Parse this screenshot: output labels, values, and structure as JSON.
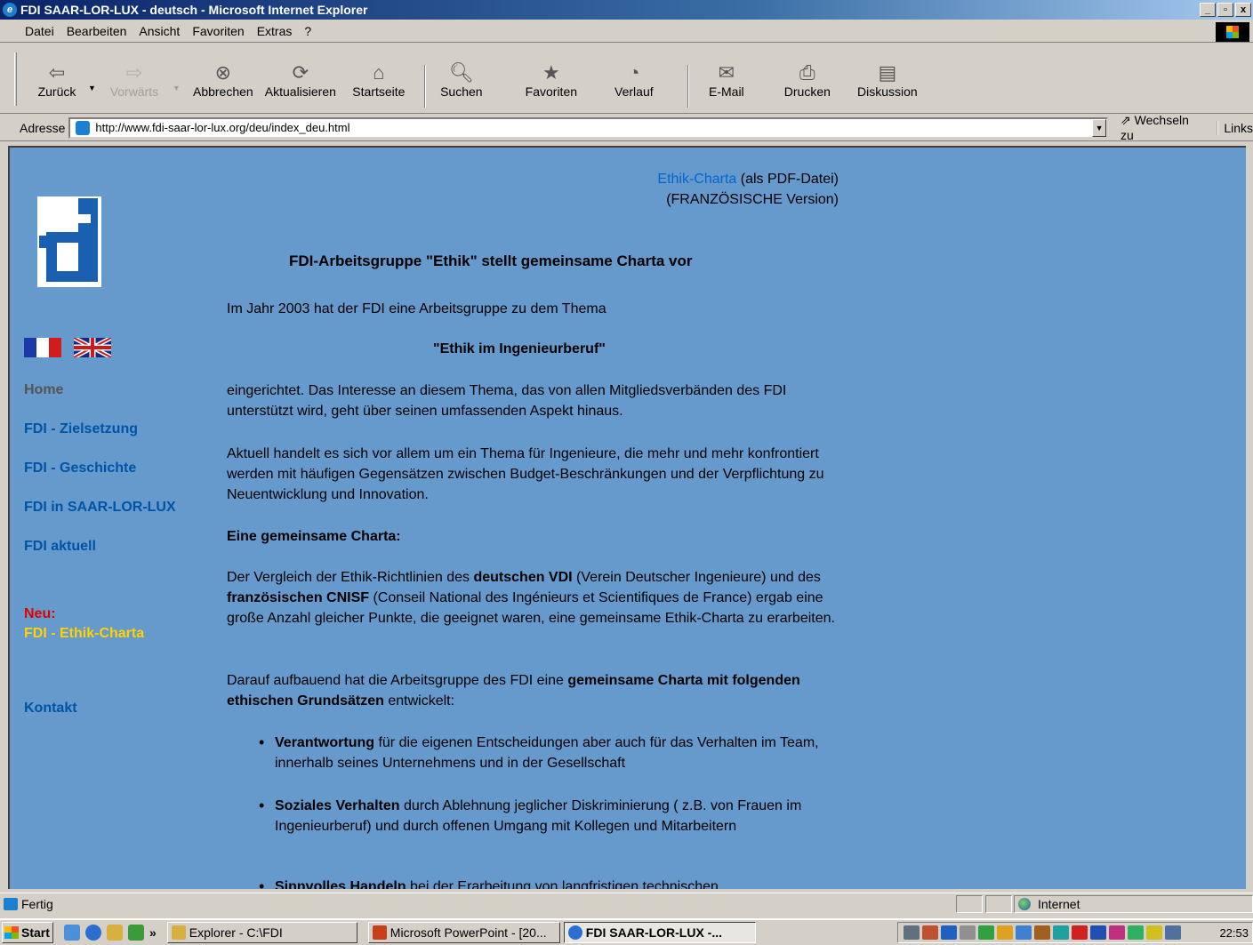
{
  "window": {
    "title": "FDI SAAR-LOR-LUX - deutsch - Microsoft Internet Explorer",
    "minimize": "_",
    "maximize": "▫",
    "close": "x"
  },
  "menu": [
    "Datei",
    "Bearbeiten",
    "Ansicht",
    "Favoriten",
    "Extras",
    "?"
  ],
  "toolbar": {
    "back": "Zurück",
    "forward": "Vorwärts",
    "stop": "Abbrechen",
    "refresh": "Aktualisieren",
    "home": "Startseite",
    "search": "Suchen",
    "favorites": "Favoriten",
    "history": "Verlauf",
    "mail": "E-Mail",
    "print": "Drucken",
    "discuss": "Diskussion"
  },
  "address": {
    "label": "Adresse",
    "url": "http://www.fdi-saar-lor-lux.org/deu/index_deu.html",
    "go": "Wechseln zu",
    "links": "Links"
  },
  "sidebar": {
    "home": "Home",
    "zielsetzung": "FDI - Zielsetzung",
    "geschichte": "FDI - Geschichte",
    "saarlorlux": "FDI in SAAR-LOR-LUX",
    "aktuell": "FDI aktuell",
    "neu": "Neu:",
    "ethik": "FDI - Ethik-Charta",
    "kontakt": "Kontakt"
  },
  "content": {
    "pdf_link": "Ethik-Charta",
    "pdf_suffix": " (als PDF-Datei)",
    "pdf_version": "(FRANZÖSISCHE Version)",
    "heading": "FDI-Arbeitsgruppe \"Ethik\" stellt gemeinsame Charta vor",
    "intro": "Im Jahr 2003 hat der FDI eine Arbeitsgruppe zu dem Thema",
    "theme": "\"Ethik im Ingenieurberuf\"",
    "p1": "eingerichtet. Das Interesse an diesem Thema, das von allen Mitgliedsverbänden des FDI unterstützt wird, geht über seinen umfassenden Aspekt hinaus.",
    "p2": "Aktuell handelt es sich vor allem um ein Thema für Ingenieure, die mehr und mehr konfrontiert werden mit häufigen Gegensätzen zwischen Budget-Beschränkungen und der Verpflichtung zu Neuentwicklung und Innovation.",
    "sub": "Eine gemeinsame Charta:",
    "p3_a": "Der Vergleich der Ethik-Richtlinien des ",
    "p3_b": "deutschen VDI",
    "p3_c": " (Verein Deutscher Ingenieure) und des ",
    "p3_d": "französischen CNISF",
    "p3_e": " (Conseil National des Ingénieurs et Scientifiques de France) ergab eine große Anzahl gleicher Punkte, die geeignet waren, eine gemeinsame Ethik-Charta zu erarbeiten.",
    "p4_a": "Darauf aufbauend hat die Arbeitsgruppe des FDI eine ",
    "p4_b": "gemeinsame Charta mit folgenden ethischen Grundsätzen",
    "p4_c": " entwickelt:",
    "li1_b": "Verantwortung",
    "li1_t": " für die eigenen Entscheidungen aber auch für das Verhalten im Team, innerhalb seines Unternehmens und in der Gesellschaft",
    "li2_b": "Soziales Verhalten",
    "li2_t": " durch Ablehnung jeglicher Diskriminierung ( z.B. von Frauen im Ingenieurberuf) und durch offenen Umgang mit Kollegen und Mitarbeitern",
    "li3_b": "Sinnvolles Handeln",
    "li3_t": " bei der Erarbeitung von langfristigen technischen"
  },
  "status": {
    "text": "Fertig",
    "zone": "Internet"
  },
  "taskbar": {
    "start": "Start",
    "chevron": "»",
    "task1": "Explorer - C:\\FDI",
    "task2": "Microsoft PowerPoint - [20...",
    "task3": "FDI SAAR-LOR-LUX -...",
    "clock": "22:53"
  }
}
